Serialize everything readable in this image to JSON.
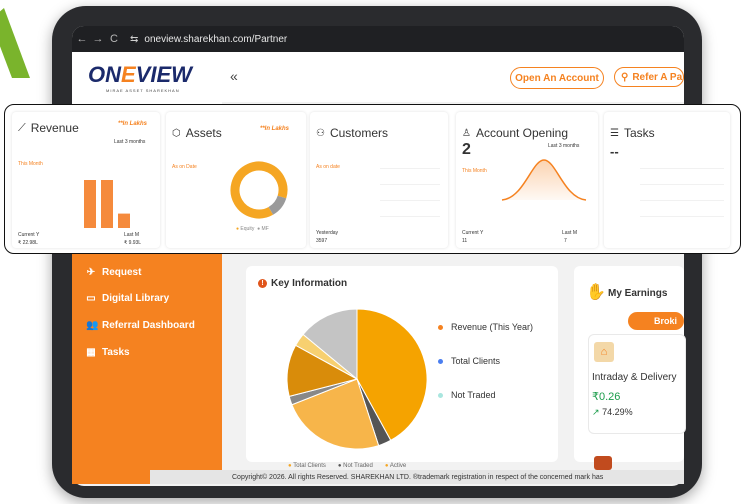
{
  "browser": {
    "url": "oneview.sharekhan.com/Partner",
    "back": "←",
    "forward": "→",
    "reload": "C",
    "tune": "⇆"
  },
  "logo": {
    "text_pre": "ON",
    "text_e": "E",
    "text_post": "VIEW",
    "sub": "MIRAE ASSET SHAREKHAN"
  },
  "topbar": {
    "collapse": "«",
    "open_account": "Open An Account",
    "refer": "Refer A Pa"
  },
  "sidebar": {
    "items": [
      {
        "label": "Request",
        "icon": "send-icon",
        "glyph": "✈"
      },
      {
        "label": "Digital Library",
        "icon": "chat-icon",
        "glyph": "▭"
      },
      {
        "label": "Referral Dashboard",
        "icon": "users-icon",
        "glyph": "👥"
      },
      {
        "label": "Tasks",
        "icon": "calendar-icon",
        "glyph": "▦"
      }
    ]
  },
  "cards": {
    "revenue": {
      "title": "Revenue",
      "lakhs": "**In Lakhs",
      "period": "Last 3 months",
      "this_month": "This Month",
      "current_label": "Current Y",
      "current_value": "₹ 22.98L",
      "last_label": "Last M",
      "last_value": "₹ 9.93L",
      "chart_data": {
        "type": "bar",
        "categories": [
          "",
          "",
          ""
        ],
        "values": [
          1.0,
          1.0,
          0.3
        ]
      }
    },
    "assets": {
      "title": "Assets",
      "lakhs": "**In Lakhs",
      "as_on": "As on Date",
      "legend": [
        "Equity",
        "MF"
      ],
      "chart_data": {
        "type": "pie",
        "categories": [
          "Equity",
          "MF"
        ],
        "values": [
          88,
          12
        ]
      }
    },
    "customers": {
      "title": "Customers",
      "as_on": "As on date",
      "yesterday_label": "Yesterday",
      "yesterday_value": "3597"
    },
    "account_opening": {
      "title": "Account Opening",
      "value": "2",
      "period": "Last 3 months",
      "this_month": "This Month",
      "current_label": "Current Y",
      "current_value": "11",
      "last_label": "Last M",
      "last_value": "7"
    },
    "tasks": {
      "title": "Tasks",
      "value": "--"
    }
  },
  "key_information": {
    "title": "Key Information",
    "legend": [
      {
        "label": "Revenue (This Year)",
        "color": "#f58220"
      },
      {
        "label": "Total Clients",
        "color": "#4a7ef0"
      },
      {
        "label": "Not Traded",
        "color": "#a9e6df"
      }
    ],
    "bottom_legend": [
      "Total Clients",
      "Not Traded",
      "Active"
    ],
    "chart_data": {
      "type": "pie",
      "categories": [
        "Revenue (This Year)",
        "Not Traded",
        "Total Clients",
        "Not Traded",
        "Active",
        "Total Clients",
        "Not Traded"
      ],
      "values": [
        42,
        3,
        24,
        2,
        12,
        3,
        14
      ]
    }
  },
  "earnings": {
    "title": "My Earnings",
    "tab": "Broki",
    "item_label": "Intraday & Delivery",
    "item_value": "₹0.26",
    "item_change": "74.29%",
    "up_arrow": "↗"
  },
  "footer": {
    "text": "Copyright© 2026. All rights Reserved. SHAREKHAN LTD. ®trademark registration in respect of the concerned mark has"
  }
}
